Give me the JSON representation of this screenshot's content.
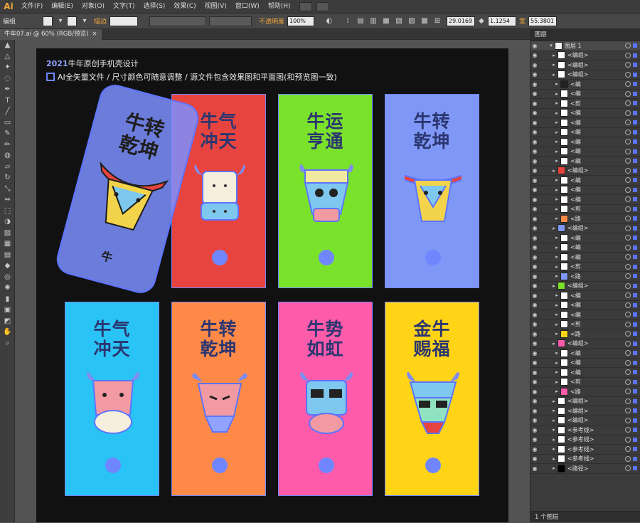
{
  "menubar": {
    "logo": "Ai",
    "items": [
      "文件(F)",
      "编辑(E)",
      "对象(O)",
      "文字(T)",
      "选择(S)",
      "效果(C)",
      "视图(V)",
      "窗口(W)",
      "帮助(H)"
    ]
  },
  "control": {
    "selection_label": "编组",
    "stroke_label": "描边",
    "opacity_label": "不透明度",
    "opacity_value": "100%",
    "x_value": "29.0169",
    "y_value": "1.1254",
    "w_label": "宽",
    "w_value": "55.3801"
  },
  "document": {
    "tab_name": "牛年07.ai @ 60% (RGB/预览)",
    "close_glyph": "×"
  },
  "artboard": {
    "title_badge": "2021",
    "title": "牛年原创手机壳设计",
    "subtitle": "AI全矢量文件 / 尺寸颜色可随意调整 / 源文件包含效果图和平面图(和预览图一致)"
  },
  "phone": {
    "line1": "牛转",
    "line2": "乾坤",
    "mark": "牛"
  },
  "cards": [
    {
      "color": "#e8443f",
      "line1": "牛气",
      "line2": "冲天"
    },
    {
      "color": "#7be22c",
      "line1": "牛运",
      "line2": "亨通"
    },
    {
      "color": "#7f98f6",
      "line1": "牛转",
      "line2": "乾坤"
    },
    {
      "color": "#29c3f5",
      "line1": "牛气",
      "line2": "冲天"
    },
    {
      "color": "#ff8a48",
      "line1": "牛转",
      "line2": "乾坤"
    },
    {
      "color": "#ff5bab",
      "line1": "牛势",
      "line2": "如虹"
    },
    {
      "color": "#ffd416",
      "line1": "金牛",
      "line2": "赐福"
    }
  ],
  "layers": {
    "title": "图层",
    "top_layer": "图层 1",
    "rows": [
      {
        "name": "<编组>",
        "thumb": "#ffffff",
        "level": 1
      },
      {
        "name": "<编组>",
        "thumb": "#ffffff",
        "level": 1
      },
      {
        "name": "<编组>",
        "thumb": "#ffffff",
        "level": 1
      },
      {
        "name": "<编",
        "thumb": "#222222",
        "level": 2
      },
      {
        "name": "<编",
        "thumb": "#ffffff",
        "level": 2
      },
      {
        "name": "<剪",
        "thumb": "#ffffff",
        "level": 2
      },
      {
        "name": "<编",
        "thumb": "#ffffff",
        "level": 2
      },
      {
        "name": "<编",
        "thumb": "#ffffff",
        "level": 2
      },
      {
        "name": "<编",
        "thumb": "#ffffff",
        "level": 2
      },
      {
        "name": "<编",
        "thumb": "#ffffff",
        "level": 2
      },
      {
        "name": "<编",
        "thumb": "#ffffff",
        "level": 2
      },
      {
        "name": "<编",
        "thumb": "#ffffff",
        "level": 2
      },
      {
        "name": "<编组>",
        "thumb": "#e8443f",
        "level": 1
      },
      {
        "name": "<编",
        "thumb": "#ffffff",
        "level": 2
      },
      {
        "name": "<编",
        "thumb": "#ffffff",
        "level": 2
      },
      {
        "name": "<编",
        "thumb": "#ffffff",
        "level": 2
      },
      {
        "name": "<剪",
        "thumb": "#ffffff",
        "level": 2
      },
      {
        "name": "<路",
        "thumb": "#ff8a48",
        "level": 2
      },
      {
        "name": "<编组>",
        "thumb": "#7f98f6",
        "level": 1
      },
      {
        "name": "<编",
        "thumb": "#ffffff",
        "level": 2
      },
      {
        "name": "<编",
        "thumb": "#ffffff",
        "level": 2
      },
      {
        "name": "<编",
        "thumb": "#ffffff",
        "level": 2
      },
      {
        "name": "<剪",
        "thumb": "#ffffff",
        "level": 2
      },
      {
        "name": "<路",
        "thumb": "#7f98f6",
        "level": 2
      },
      {
        "name": "<编组>",
        "thumb": "#7be22c",
        "level": 1
      },
      {
        "name": "<编",
        "thumb": "#ffffff",
        "level": 2
      },
      {
        "name": "<编",
        "thumb": "#ffffff",
        "level": 2
      },
      {
        "name": "<编",
        "thumb": "#ffffff",
        "level": 2
      },
      {
        "name": "<剪",
        "thumb": "#ffffff",
        "level": 2
      },
      {
        "name": "<路",
        "thumb": "#ffd416",
        "level": 2
      },
      {
        "name": "<编组>",
        "thumb": "#ff5bab",
        "level": 1
      },
      {
        "name": "<编",
        "thumb": "#ffffff",
        "level": 2
      },
      {
        "name": "<编",
        "thumb": "#ffffff",
        "level": 2
      },
      {
        "name": "<编",
        "thumb": "#ffffff",
        "level": 2
      },
      {
        "name": "<剪",
        "thumb": "#ffffff",
        "level": 2
      },
      {
        "name": "<路",
        "thumb": "#ff5bab",
        "level": 2
      },
      {
        "name": "<编组>",
        "thumb": "#ffffff",
        "level": 1
      },
      {
        "name": "<编组>",
        "thumb": "#ffffff",
        "level": 1
      },
      {
        "name": "<编组>",
        "thumb": "#ffffff",
        "level": 1
      },
      {
        "name": "<参考线>",
        "thumb": "#ffffff",
        "level": 1
      },
      {
        "name": "<参考线>",
        "thumb": "#ffffff",
        "level": 1
      },
      {
        "name": "<参考线>",
        "thumb": "#ffffff",
        "level": 1
      },
      {
        "name": "<参考线>",
        "thumb": "#ffffff",
        "level": 1
      },
      {
        "name": "<路径>",
        "thumb": "#000000",
        "level": 1
      }
    ],
    "footer": "1 个图层"
  },
  "tools": [
    "selection",
    "direct-selection",
    "magic-wand",
    "lasso",
    "pen",
    "type",
    "line",
    "rectangle",
    "paintbrush",
    "pencil",
    "blob-brush",
    "eraser",
    "rotate",
    "scale",
    "width",
    "free-transform",
    "shape-builder",
    "perspective",
    "mesh",
    "gradient",
    "eyedropper",
    "blend",
    "symbol-sprayer",
    "column-graph",
    "artboard",
    "slice",
    "hand",
    "zoom"
  ]
}
